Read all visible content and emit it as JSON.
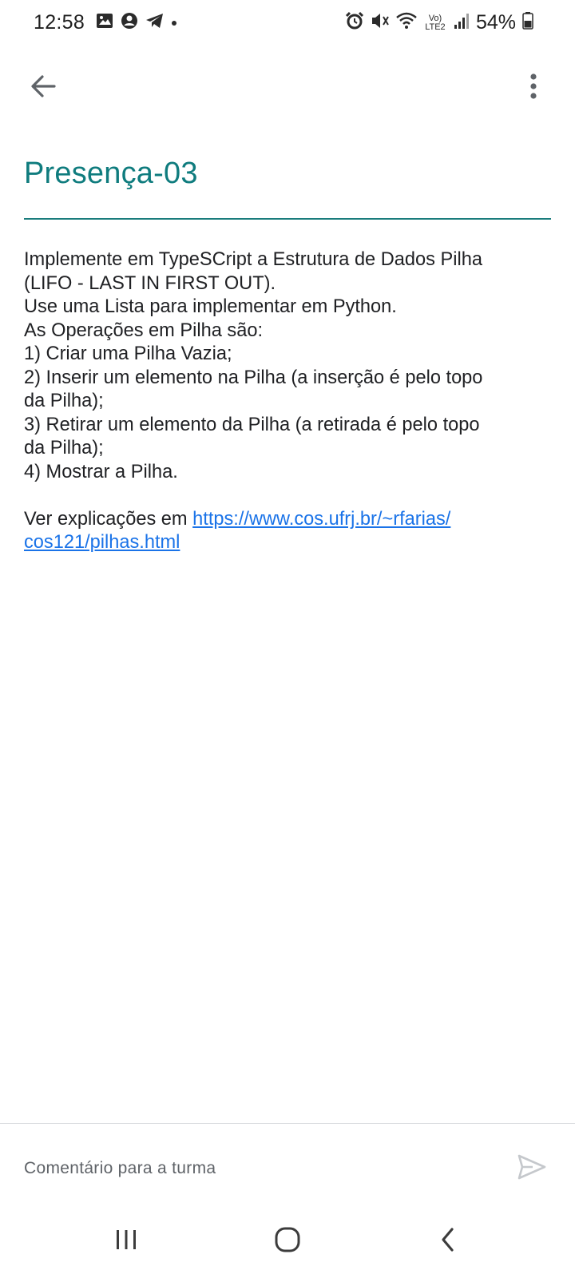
{
  "status_bar": {
    "time": "12:58",
    "battery": "54%",
    "left_icons": [
      "gallery-icon",
      "account-icon",
      "telegram-icon",
      "notification-dot-icon"
    ],
    "right_icons": [
      "alarm-icon",
      "mute-icon",
      "wifi-icon",
      "volte-lte2-icon",
      "signal-icon",
      "battery-icon"
    ],
    "network_label": "Vo) LTE2"
  },
  "app_bar": {
    "back_icon": "arrow-back-icon",
    "menu_icon": "more-vert-icon"
  },
  "post": {
    "title": "Presença-03",
    "body_lines": [
      "Implemente em TypeSCript a Estrutura de Dados Pilha",
      "(LIFO - LAST IN FIRST OUT).",
      "Use uma Lista para implementar em Python.",
      "As Operações em Pilha são:",
      "1) Criar uma Pilha Vazia;",
      "2) Inserir um elemento na Pilha (a inserção é pelo topo",
      "da Pilha);",
      "3) Retirar um elemento da Pilha (a retirada é pelo topo",
      "da Pilha);",
      "4) Mostrar a Pilha."
    ],
    "link_prefix": "Ver explicações em ",
    "link_part1": "https://www.cos.ufrj.br/~rfarias/",
    "link_part2": "cos121/pilhas.html"
  },
  "comment": {
    "placeholder": "Comentário para a turma",
    "value": "",
    "send_icon": "send-icon"
  },
  "nav_bar": {
    "items": [
      "recents-icon",
      "home-icon",
      "back-nav-icon"
    ]
  },
  "colors": {
    "accent": "#0f7c7e",
    "link": "#1a73e8",
    "text": "#202124",
    "hint": "#5f6368"
  }
}
